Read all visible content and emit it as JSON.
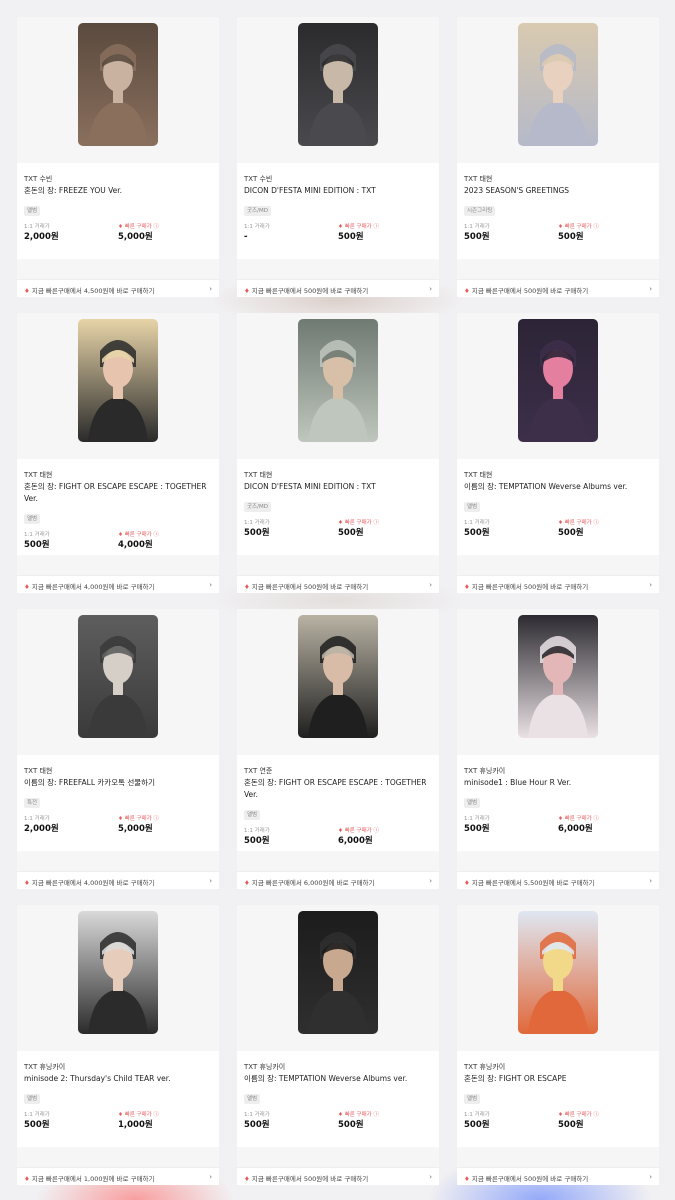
{
  "labels": {
    "direct_trade": "1:1 거래가",
    "quick_buy": "빠른 구매가",
    "quick_icon": "fire-icon"
  },
  "cards": [
    {
      "artist": "TXT 수빈",
      "title": "혼돈의 장: FREEZE YOU Ver.",
      "badge": "앨범",
      "price_direct": "2,000원",
      "price_quick": "5,000원",
      "promo": "지금 빠른구매에서 4,500원에 바로 구매하기",
      "colors": [
        "#5a4a3e",
        "#c9b3a0",
        "#8a6f5d"
      ]
    },
    {
      "artist": "TXT 수빈",
      "title": "DICON D'FESTA MINI EDITION : TXT",
      "badge": "굿즈/MD",
      "price_direct": "-",
      "price_quick": "500원",
      "promo": "지금 빠른구매에서 500원에 바로 구매하기",
      "colors": [
        "#2b2b2e",
        "#c7b8a8",
        "#4a4a4e"
      ]
    },
    {
      "artist": "TXT 태현",
      "title": "2023 SEASON'S GREETINGS",
      "badge": "시즌그리팅",
      "price_direct": "500원",
      "price_quick": "500원",
      "promo": "지금 빠른구매에서 500원에 바로 구매하기",
      "colors": [
        "#d9cab0",
        "#e8d2bf",
        "#b5b9c9"
      ]
    },
    {
      "artist": "TXT 태현",
      "title": "혼돈의 장: FIGHT OR ESCAPE ESCAPE : TOGETHER Ver.",
      "badge": "앨범",
      "price_direct": "500원",
      "price_quick": "4,000원",
      "promo": "지금 빠른구매에서 4,000원에 바로 구매하기",
      "colors": [
        "#e7d4a8",
        "#e6c4ad",
        "#2a2a2a"
      ]
    },
    {
      "artist": "TXT 태현",
      "title": "DICON D'FESTA MINI EDITION : TXT",
      "badge": "굿즈/MD",
      "price_direct": "500원",
      "price_quick": "500원",
      "promo": "지금 빠른구매에서 500원에 바로 구매하기",
      "colors": [
        "#6f7a72",
        "#d8c0a8",
        "#bfc6bd"
      ]
    },
    {
      "artist": "TXT 태현",
      "title": "이름의 장: TEMPTATION Weverse Albums ver.",
      "badge": "앨범",
      "price_direct": "500원",
      "price_quick": "500원",
      "promo": "지금 빠른구매에서 500원에 바로 구매하기",
      "colors": [
        "#2c2436",
        "#e47fa0",
        "#3d2f4a"
      ]
    },
    {
      "artist": "TXT 태현",
      "title": "이름의 장: FREEFALL 카카오톡 선물하기",
      "badge": "특전",
      "price_direct": "2,000원",
      "price_quick": "5,000원",
      "promo": "지금 빠른구매에서 4,000원에 바로 구매하기",
      "colors": [
        "#5e5e5e",
        "#d6cfc8",
        "#3a3a3a"
      ]
    },
    {
      "artist": "TXT 연준",
      "title": "혼돈의 장: FIGHT OR ESCAPE ESCAPE : TOGETHER Ver.",
      "badge": "앨범",
      "price_direct": "500원",
      "price_quick": "6,000원",
      "promo": "지금 빠른구매에서 6,000원에 바로 구매하기",
      "colors": [
        "#b9b3a4",
        "#d9bca8",
        "#1f1f1f"
      ]
    },
    {
      "artist": "TXT 휴닝카이",
      "title": "minisode1 : Blue Hour R Ver.",
      "badge": "앨범",
      "price_direct": "500원",
      "price_quick": "6,000원",
      "promo": "지금 빠른구매에서 5,500원에 바로 구매하기",
      "colors": [
        "#2c2a30",
        "#e3b7b7",
        "#e9e1e4"
      ]
    },
    {
      "artist": "TXT 휴닝카이",
      "title": "minisode 2: Thursday's Child TEAR ver.",
      "badge": "앨범",
      "price_direct": "500원",
      "price_quick": "1,000원",
      "promo": "지금 빠른구매에서 1,000원에 바로 구매하기",
      "colors": [
        "#d9d9d9",
        "#e6cdbb",
        "#2b2b2b"
      ]
    },
    {
      "artist": "TXT 휴닝카이",
      "title": "이름의 장: TEMPTATION Weverse Albums ver.",
      "badge": "앨범",
      "price_direct": "500원",
      "price_quick": "500원",
      "promo": "지금 빠른구매에서 500원에 바로 구매하기",
      "colors": [
        "#1c1c1c",
        "#c9a890",
        "#2f2f2f"
      ]
    },
    {
      "artist": "TXT 휴닝카이",
      "title": "혼돈의 장: FIGHT OR ESCAPE",
      "badge": "앨범",
      "price_direct": "500원",
      "price_quick": "500원",
      "promo": "지금 빠른구매에서 500원에 바로 구매하기",
      "colors": [
        "#dfe7f2",
        "#f2d98a",
        "#e0683a"
      ]
    }
  ]
}
